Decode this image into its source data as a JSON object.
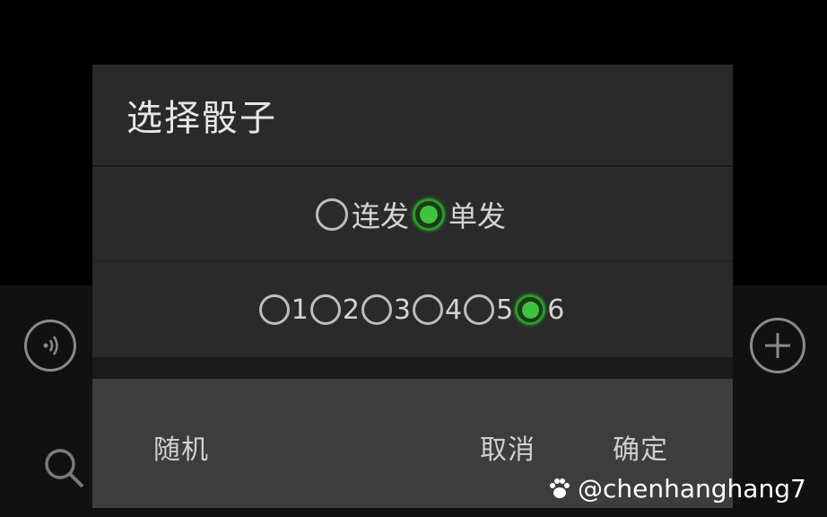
{
  "dialog": {
    "title": "选择骰子",
    "mode_options": [
      {
        "label": "连发",
        "checked": false
      },
      {
        "label": "单发",
        "checked": true
      }
    ],
    "count_options": [
      {
        "label": "1",
        "checked": false
      },
      {
        "label": "2",
        "checked": false
      },
      {
        "label": "3",
        "checked": false
      },
      {
        "label": "4",
        "checked": false
      },
      {
        "label": "5",
        "checked": false
      },
      {
        "label": "6",
        "checked": true
      }
    ],
    "buttons": {
      "random": "随机",
      "cancel": "取消",
      "confirm": "确定"
    }
  },
  "chat_bar": {
    "left_icon": "voice-icon",
    "right_icon": "plus-icon",
    "bottom_icon": "search-icon"
  },
  "watermark": {
    "text": "@chenhanghang7",
    "icon": "paw-icon"
  },
  "colors": {
    "accent": "#3fc43f",
    "dialog_bg": "#2a2a2a",
    "actions_bg": "#3d3d3d"
  }
}
